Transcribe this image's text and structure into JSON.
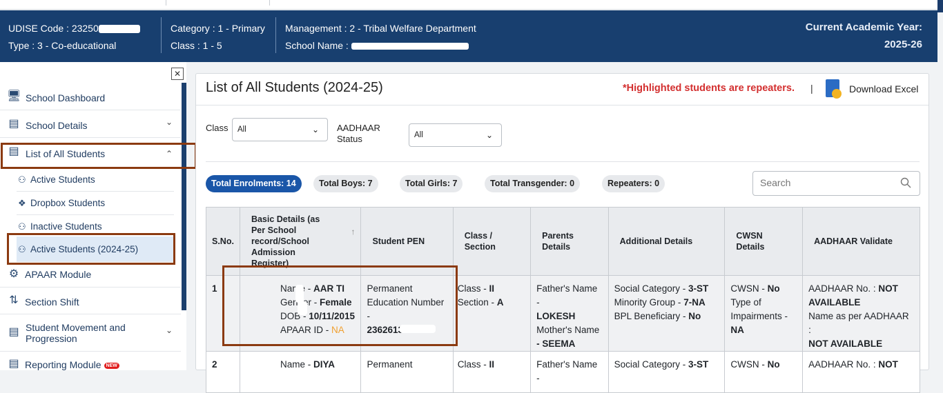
{
  "header": {
    "udise_label": "UDISE Code : 23250",
    "type": "Type : 3 - Co-educational",
    "category": "Category : 1 - Primary",
    "class_range": "Class : 1 - 5",
    "management": "Management : 2 - Tribal Welfare Department",
    "school_name_label": "School Name :",
    "year_label": "Current Academic Year:",
    "year_value": "2025-26"
  },
  "sidebar": {
    "close": "✕",
    "items": [
      {
        "label": "School Dashboard"
      },
      {
        "label": "School Details",
        "chevron": "⌄"
      },
      {
        "label": "List of All Students",
        "chevron": "⌃"
      },
      {
        "label": "APAAR Module"
      },
      {
        "label": "Section Shift"
      },
      {
        "label": "Student Movement and Progression",
        "chevron": "⌄"
      },
      {
        "label": "Reporting Module",
        "badge": "NEW"
      }
    ],
    "subitems": [
      {
        "label": "Active Students"
      },
      {
        "label": "Dropbox Students"
      },
      {
        "label": "Inactive Students"
      },
      {
        "label": "Active Students (2024-25)"
      }
    ]
  },
  "panel": {
    "title": "List of All Students (2024-25)",
    "repeater_note": "*Highlighted students are repeaters.",
    "pipe": "|",
    "download_label": "Download Excel",
    "filters": {
      "class_label": "Class",
      "class_value": "All",
      "aadhaar_label_1": "AADHAAR",
      "aadhaar_label_2": "Status",
      "aadhaar_value": "All"
    },
    "stats": {
      "enrolments": "Total Enrolments: 14",
      "boys": "Total Boys: 7",
      "girls": "Total Girls: 7",
      "transgender": "Total Transgender: 0",
      "repeaters": "Repeaters: 0"
    },
    "search_placeholder": "Search"
  },
  "table": {
    "headers": {
      "sno": "S.No.",
      "basic": "Basic Details (as Per School record/School Admission Register)",
      "pen": "Student PEN",
      "class": "Class / Section",
      "parents": "Parents Details",
      "additional": "Additional Details",
      "cwsn": "CWSN Details",
      "aadhaar": "AADHAAR Validate"
    },
    "rows": [
      {
        "sno": "1",
        "name_label": "Name - ",
        "name": "AAR TI",
        "gender_label": "Gender - ",
        "gender": "Female",
        "dob_label": "DOB - ",
        "dob": "10/11/2015",
        "apaar_label": "APAAR ID - ",
        "apaar": "NA",
        "pen_line1": "Permanent",
        "pen_line2": "Education Number",
        "pen_line3": "-",
        "pen_value": "23626133",
        "class_label": "Class - ",
        "class": "II",
        "section_label": "Section - ",
        "section": "A",
        "father_label": "Father's Name -",
        "father": "LOKESH",
        "mother_label": "Mother's Name",
        "mother": "- SEEMA",
        "social_label": "Social Category - ",
        "social": "3-ST",
        "minority_label": "Minority Group - ",
        "minority": "7-NA",
        "bpl_label": "BPL Beneficiary - ",
        "bpl": "No",
        "cwsn_label": "CWSN - ",
        "cwsn": "No",
        "impair_label": "Type of Impairments -",
        "impair": "NA",
        "aadhaar_label": "AADHAAR No. : ",
        "aadhaar": "NOT AVAILABLE",
        "aname_label": "Name as per AADHAAR :",
        "aname": "NOT AVAILABLE"
      },
      {
        "sno": "2",
        "name_label": "Name - ",
        "name": "DIYA",
        "pen_line1": "Permanent",
        "class_label": "Class - ",
        "class": "II",
        "father_label": "Father's Name -",
        "social_label": "Social Category - ",
        "social": "3-ST",
        "cwsn_label": "CWSN - ",
        "cwsn": "No",
        "aadhaar_label": "AADHAAR No. : ",
        "aadhaar": "NOT"
      }
    ]
  },
  "colors": {
    "header_bg": "#183f6f",
    "primary_pill": "#1a56a8",
    "repeater_red": "#d32f2f",
    "highlight_box": "#8b3a10",
    "na_orange": "#f0a030"
  }
}
